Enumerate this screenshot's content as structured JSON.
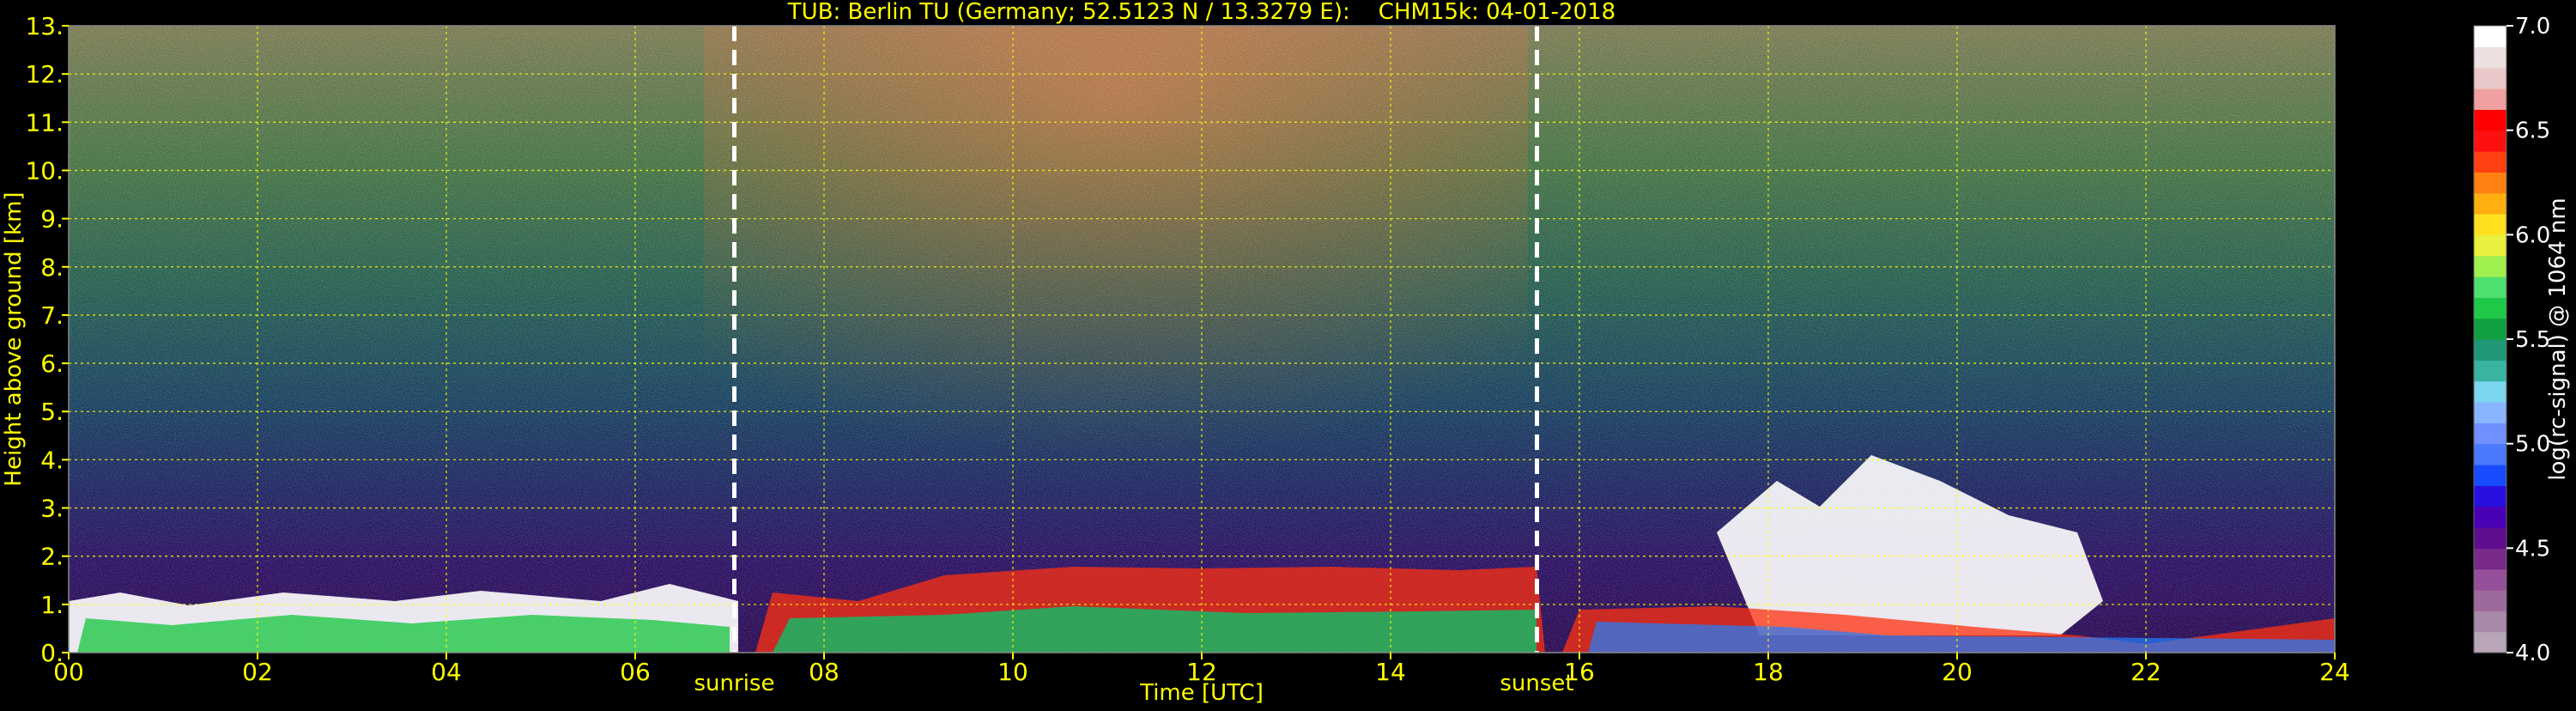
{
  "title": "TUB: Berlin TU (Germany; 52.5123 N / 13.3279 E):    CHM15k: 04-01-2018",
  "colors": {
    "background": "#000000",
    "text": "#ffff00",
    "grid": "#ffff00",
    "event_line": "#ffffff",
    "colorbar_label": "#ffffff"
  },
  "chart_data": {
    "type": "heatmap",
    "title": "TUB: Berlin TU (Germany; 52.5123 N / 13.3279 E):    CHM15k: 04-01-2018",
    "xlabel": "Time [UTC]",
    "ylabel": "Height above ground [km]",
    "xlim": [
      0,
      24
    ],
    "ylim": [
      0,
      13
    ],
    "grid": true,
    "x_ticks": [
      0,
      2,
      4,
      6,
      8,
      10,
      12,
      14,
      16,
      18,
      20,
      22,
      24
    ],
    "x_tick_labels": [
      "00",
      "02",
      "04",
      "06",
      "08",
      "10",
      "12",
      "14",
      "16",
      "18",
      "20",
      "22",
      "24"
    ],
    "y_ticks": [
      0,
      1,
      2,
      3,
      4,
      5,
      6,
      7,
      8,
      9,
      10,
      11,
      12,
      13
    ],
    "y_tick_labels": [
      "0.",
      "1.",
      "2.",
      "3.",
      "4.",
      "5.",
      "6.",
      "7.",
      "8.",
      "9.",
      "10.",
      "11.",
      "12.",
      "13."
    ],
    "events": [
      {
        "label": "sunrise",
        "time": 7.05
      },
      {
        "label": "sunset",
        "time": 15.55
      }
    ],
    "colorbar": {
      "label": "log(rc-signal) @ 1064 nm",
      "range": [
        4.0,
        7.0
      ],
      "ticks": [
        4.0,
        4.5,
        5.0,
        5.5,
        6.0,
        6.5,
        7.0
      ],
      "tick_labels": [
        "4.0",
        "4.5",
        "5.0",
        "5.5",
        "6.0",
        "6.5",
        "7.0"
      ],
      "colors": [
        "#b8a6b8",
        "#a88aa8",
        "#9e6a9e",
        "#94509a",
        "#7a2a8a",
        "#5e0e8e",
        "#4a00b4",
        "#2a10e0",
        "#1a4cff",
        "#4a78ff",
        "#7090ff",
        "#8ab4ff",
        "#7cd6ee",
        "#38b4a0",
        "#209878",
        "#10a040",
        "#20c848",
        "#50e070",
        "#a0f050",
        "#e8f040",
        "#ffe020",
        "#ffb010",
        "#ff8010",
        "#ff4010",
        "#ff1010",
        "#ff0000",
        "#f0a0a0",
        "#e8c8c8",
        "#ece0e0",
        "#ffffff"
      ]
    }
  }
}
